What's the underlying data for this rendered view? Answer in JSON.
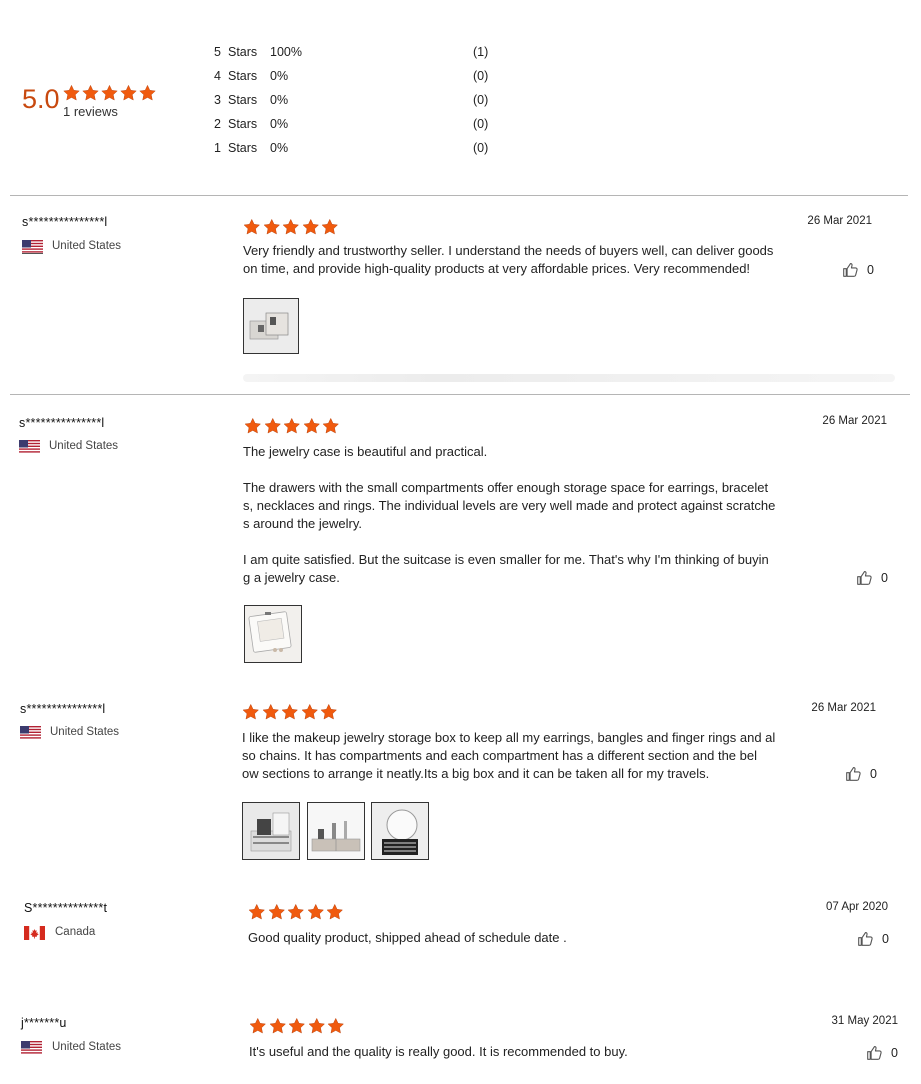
{
  "summary": {
    "score": "5.0",
    "review_count_label": "1 reviews",
    "distribution": [
      {
        "level": "5",
        "unit": "Stars",
        "percent": "100%",
        "count": "(1)"
      },
      {
        "level": "4",
        "unit": "Stars",
        "percent": "0%",
        "count": "(0)"
      },
      {
        "level": "3",
        "unit": "Stars",
        "percent": "0%",
        "count": "(0)"
      },
      {
        "level": "2",
        "unit": "Stars",
        "percent": "0%",
        "count": "(0)"
      },
      {
        "level": "1",
        "unit": "Stars",
        "percent": "0%",
        "count": "(0)"
      }
    ]
  },
  "colors": {
    "accent": "#c8490f",
    "star": "#f05a0e",
    "divider": "#b5b5b5"
  },
  "reviews": [
    {
      "user": "s***************l",
      "country": "United States",
      "flag": "us-flag-icon",
      "rating": 5,
      "date": "26 Mar 2021",
      "text_lines": [
        "Very friendly and trustworthy seller. I understand the needs of buyers well, can deliver goods",
        "on time, and provide high-quality products at very affordable prices. Very recommended!"
      ],
      "likes": "0",
      "images": 1
    },
    {
      "user": "s***************l",
      "country": "United States",
      "flag": "us-flag-icon",
      "rating": 5,
      "date": "26 Mar 2021",
      "text_lines": [
        "The jewelry case is beautiful and practical.",
        "",
        "The drawers with the small compartments offer enough storage space for earrings, bracelet",
        "s, necklaces and rings. The individual levels are very well made and protect against scratche",
        "s around the jewelry.",
        "",
        "I am quite satisfied. But the suitcase is even smaller for me. That's why I'm thinking of buyin",
        "g a jewelry case."
      ],
      "likes": "0",
      "images": 1
    },
    {
      "user": "s***************l",
      "country": "United States",
      "flag": "us-flag-icon",
      "rating": 5,
      "date": "26 Mar 2021",
      "text_lines": [
        "I like the makeup jewelry storage box to keep all my earrings, bangles and finger rings and al",
        "so chains. It has  compartments and each compartment has a different section and the bel",
        "ow sections to arrange it neatly.Its a big box and it can be taken all for my travels."
      ],
      "likes": "0",
      "images": 3
    },
    {
      "user": "S**************t",
      "country": "Canada",
      "flag": "canada-flag-icon",
      "rating": 5,
      "date": "07 Apr 2020",
      "text_lines": [
        "Good quality product, shipped ahead of schedule date ."
      ],
      "likes": "0",
      "images": 0
    },
    {
      "user": "j*******u",
      "country": "United States",
      "flag": "us-flag-icon",
      "rating": 5,
      "date": "31 May 2021",
      "text_lines": [
        "It's useful and the quality is really good. It is recommended to buy."
      ],
      "likes": "0",
      "images": 0
    }
  ]
}
